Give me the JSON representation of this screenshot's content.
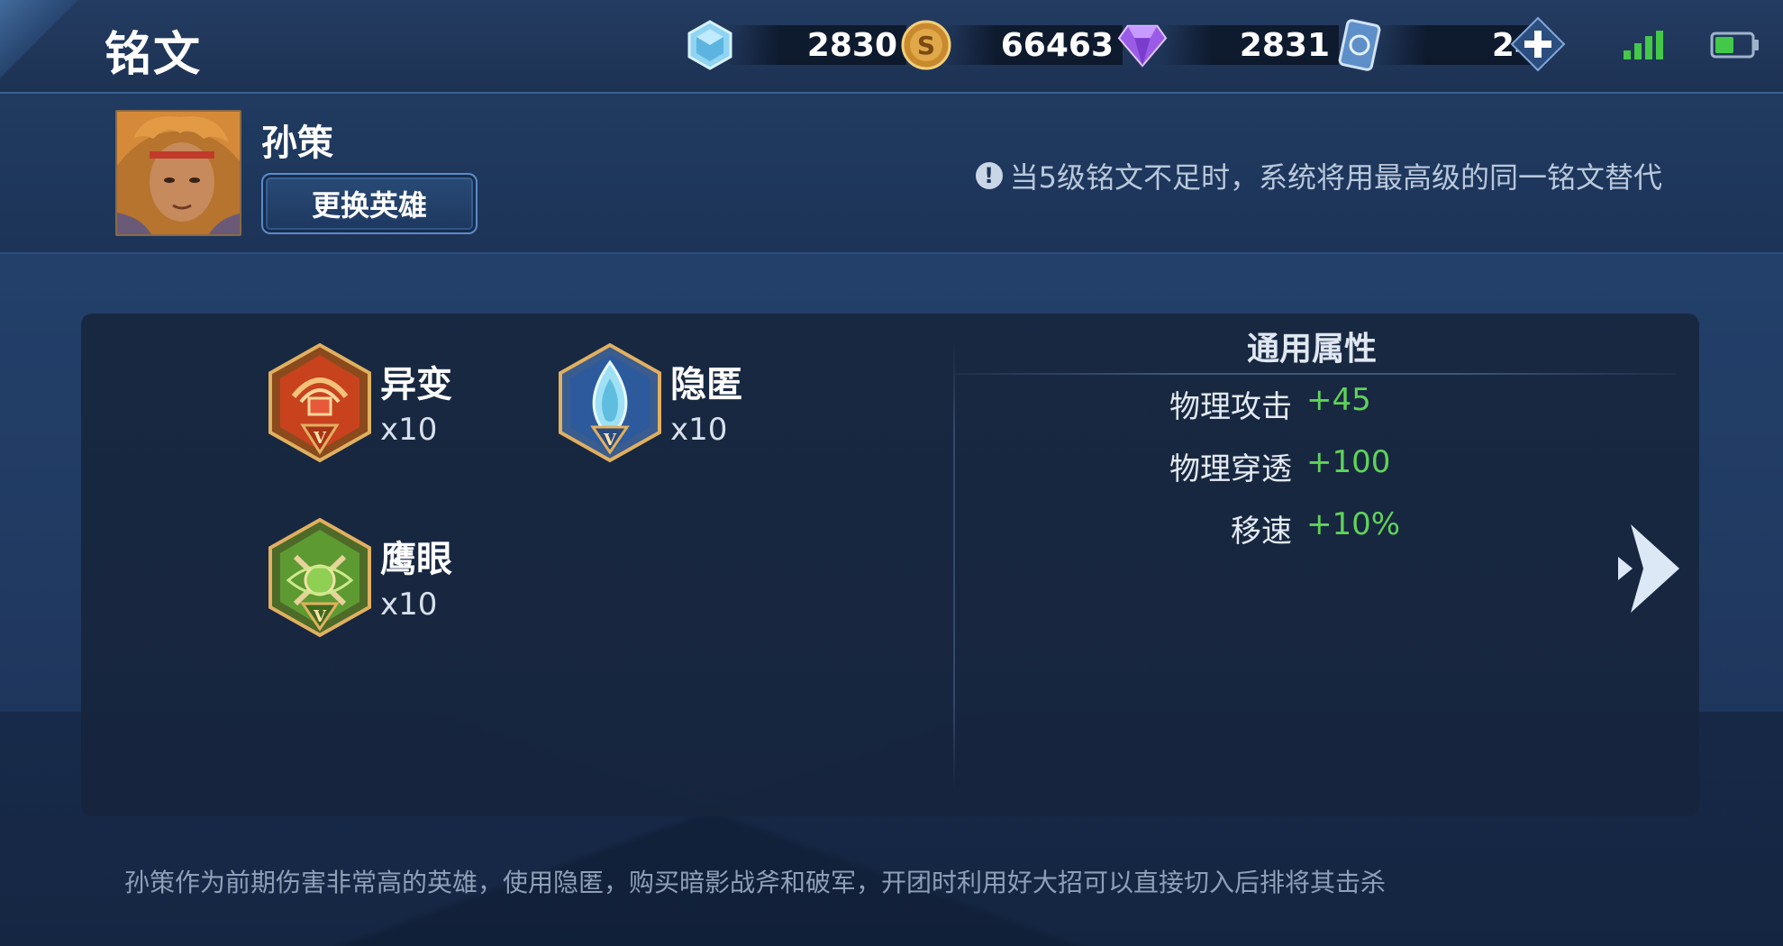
{
  "header": {
    "title": "铭文",
    "currencies": {
      "diamond": "2830",
      "gold": "66463",
      "gem": "2831",
      "ticket": "24"
    }
  },
  "hero": {
    "name": "孙策",
    "change_button": "更换英雄",
    "notice": "当5级铭文不足时，系统将用最高级的同一铭文替代"
  },
  "runes": [
    {
      "name": "异变",
      "count": "x10",
      "icon": "red-rune-icon"
    },
    {
      "name": "隐匿",
      "count": "x10",
      "icon": "blue-rune-icon"
    },
    {
      "name": "鹰眼",
      "count": "x10",
      "icon": "green-rune-icon"
    }
  ],
  "attributes": {
    "title": "通用属性",
    "rows": [
      {
        "name": "物理攻击",
        "value": "+45"
      },
      {
        "name": "物理穿透",
        "value": "+100"
      },
      {
        "name": "移速",
        "value": "+10%"
      }
    ]
  },
  "description": "孙策作为前期伤害非常高的英雄，使用隐匿，购买暗影战斧和破军，开团时利用好大招可以直接切入后排将其击杀",
  "colors": {
    "attr_value": "#5fd35a",
    "button_border": "#5b8bc8",
    "panel_bg": "#18263e"
  }
}
